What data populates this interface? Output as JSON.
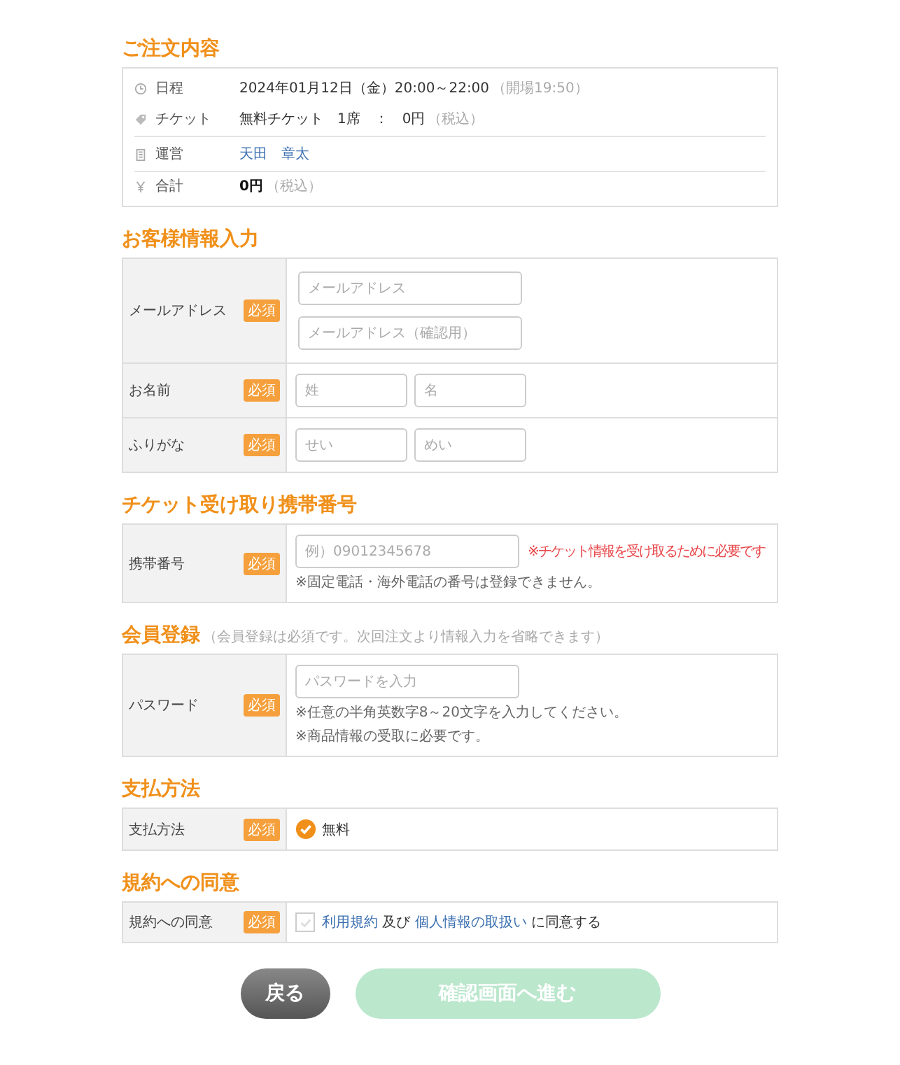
{
  "order": {
    "title": "ご注文内容",
    "rows": [
      {
        "kind": "clock",
        "label": "日程",
        "value": "2024年01月12日（金）20:00～22:00",
        "note": "（開場19:50）",
        "divider": false,
        "link": false,
        "bold": false
      },
      {
        "kind": "ticket",
        "label": "チケット",
        "value": "無料チケット　1席　：　0円",
        "note": "（税込）",
        "divider": true,
        "link": false,
        "bold": false
      },
      {
        "kind": "building",
        "label": "運営",
        "value": "天田　章太",
        "divider": true,
        "link": true,
        "bold": false
      },
      {
        "kind": "yen",
        "label": "合計",
        "value": "0円",
        "note": "（税込）",
        "divider": false,
        "link": false,
        "bold": true
      }
    ]
  },
  "sections": [
    {
      "title": "お客様情報入力",
      "rows": [
        {
          "kind": "stacked",
          "label": "メールアドレス",
          "badge": "必須",
          "fields": [
            {
              "placeholder": "メールアドレス"
            },
            {
              "placeholder": "メールアドレス（確認用）"
            }
          ]
        },
        {
          "kind": "pair",
          "label": "お名前",
          "badge": "必須",
          "fields": [
            {
              "placeholder": "姓"
            },
            {
              "placeholder": "名"
            }
          ]
        },
        {
          "kind": "pair",
          "label": "ふりがな",
          "badge": "必須",
          "fields": [
            {
              "placeholder": "せい"
            },
            {
              "placeholder": "めい"
            }
          ]
        }
      ]
    },
    {
      "title": "チケット受け取り携帯番号",
      "rows": [
        {
          "kind": "input",
          "label": "携帯番号",
          "badge": "必須",
          "field": {
            "placeholder": "例）09012345678"
          },
          "side_note": "※チケット情報を受け取るために必要です",
          "notes": [
            "※固定電話・海外電話の番号は登録できません。"
          ]
        }
      ]
    },
    {
      "title": "会員登録",
      "note": "（会員登録は必須です。次回注文より情報入力を省略できます）",
      "rows": [
        {
          "kind": "input",
          "label": "パスワード",
          "badge": "必須",
          "field": {
            "placeholder": "パスワードを入力"
          },
          "notes": [
            "※任意の半角英数字8～20文字を入力してください。",
            "※商品情報の受取に必要です。"
          ]
        }
      ]
    },
    {
      "title": "支払方法",
      "rows": [
        {
          "kind": "radio",
          "label": "支払方法",
          "badge": "必須",
          "option": "無料",
          "selected": true
        }
      ]
    },
    {
      "title": "規約への同意",
      "rows": [
        {
          "kind": "agree",
          "label": "規約への同意",
          "badge": "必須",
          "checked": false,
          "parts": [
            {
              "text": "利用規約",
              "link": true
            },
            {
              "text": " 及び ",
              "link": false
            },
            {
              "text": "個人情報の取扱い",
              "link": true
            },
            {
              "text": " に同意する",
              "link": false
            }
          ]
        }
      ]
    }
  ],
  "buttons": [
    {
      "kind": "back",
      "label": "戻る",
      "disabled": false
    },
    {
      "kind": "next",
      "label": "確認画面へ進む",
      "disabled": true
    }
  ]
}
